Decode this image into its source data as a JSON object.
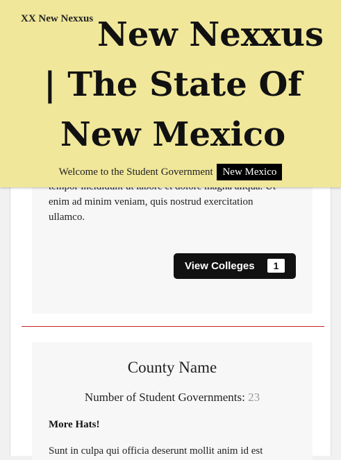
{
  "header": {
    "logo_text": "XX New Nexxus",
    "title": "New Nexxus | The State Of New Mexico",
    "welcome_text": "Welcome to the Student Government",
    "state_badge": "New Mexico"
  },
  "card1": {
    "partial_line_1": "tempor incididunt ut labore et dolore magna aliqua. Ut",
    "partial_line_2": "enim ad minim veniam, quis nostrud exercitation",
    "partial_line_3": "ullamco.",
    "button_label": "View Colleges",
    "button_count": "1"
  },
  "card2": {
    "county_name": "County Name",
    "gov_count_label": "Number of Student Governments:",
    "gov_count_value": "23",
    "subheading": "More Hats!",
    "body_start": "Sunt in culpa qui officia deserunt mollit anim id est"
  }
}
